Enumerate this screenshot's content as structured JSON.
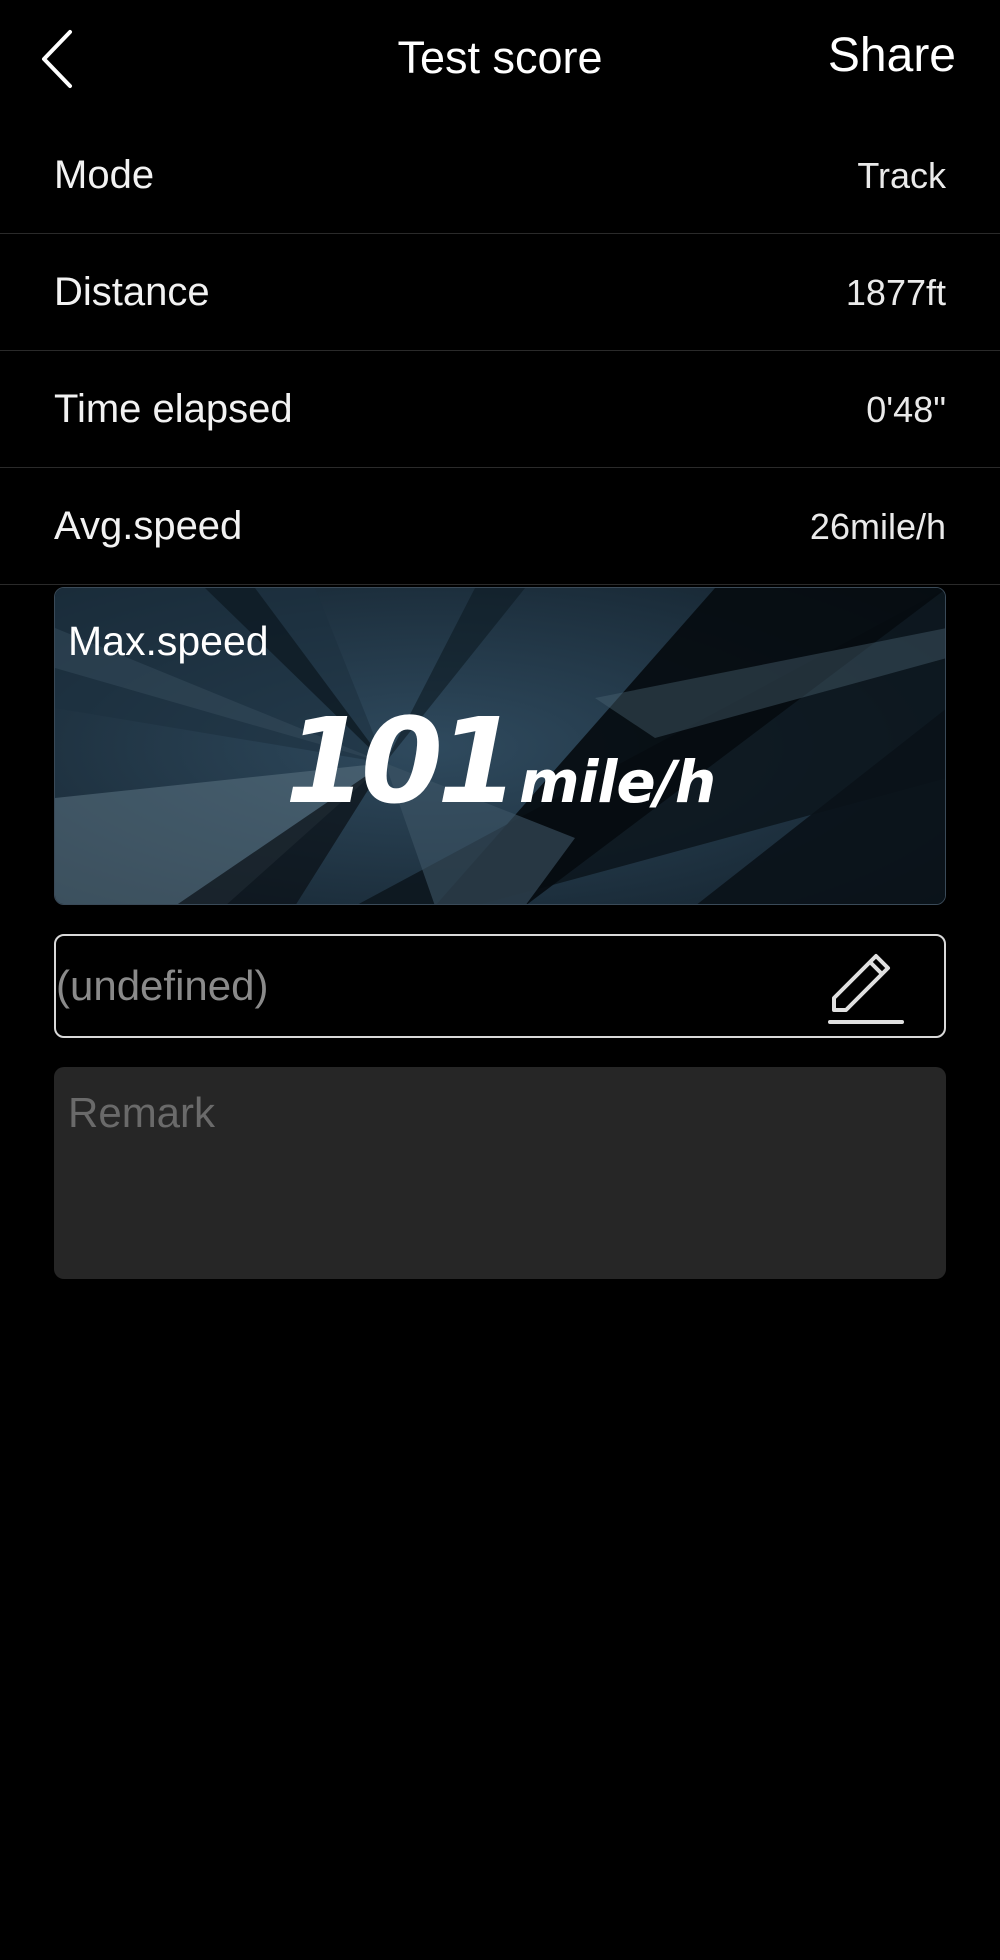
{
  "header": {
    "title": "Test score",
    "share_label": "Share",
    "back_icon": "chevron-left-icon"
  },
  "stats": [
    {
      "label": "Mode",
      "value": "Track"
    },
    {
      "label": "Distance",
      "value": "1877ft"
    },
    {
      "label": "Time elapsed",
      "value": "0'48\""
    },
    {
      "label": "Avg.speed",
      "value": "26mile/h"
    }
  ],
  "max_speed": {
    "label": "Max.speed",
    "value": "101",
    "unit": "mile/h"
  },
  "name_field": {
    "placeholder": "(undefined)",
    "edit_icon": "pencil-icon"
  },
  "remark": {
    "placeholder": "Remark"
  },
  "colors": {
    "background": "#000000",
    "card_bg": "#1b2b38",
    "remark_bg": "#262626",
    "field_border": "#d9d9d9"
  }
}
